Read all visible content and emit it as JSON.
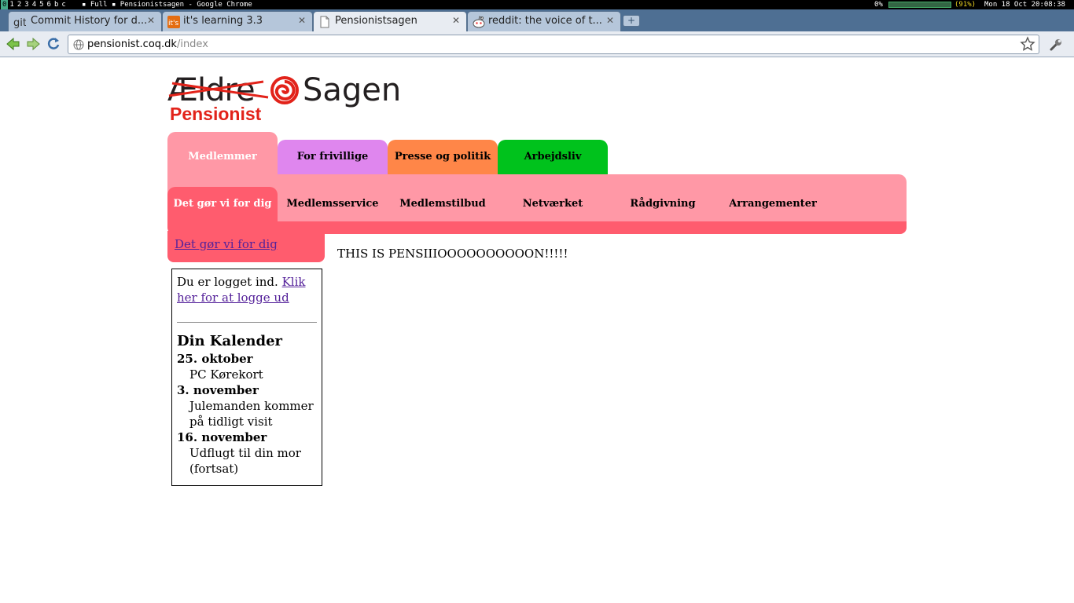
{
  "wm_bar": {
    "workspaces": [
      "0",
      "1",
      "2",
      "3",
      "4",
      "5",
      "6",
      "b",
      "c"
    ],
    "active_workspace": "0",
    "layout": "Full",
    "window_title": "Pensionistsagen - Google Chrome",
    "cpu": "0%",
    "battery": "(91%)",
    "clock": "Mon 18 Oct 20:08:38"
  },
  "browser": {
    "tabs": [
      {
        "label": "Commit History for d...",
        "favicon": "git-icon"
      },
      {
        "label": "it's learning 3.3",
        "favicon": "itslearning-icon"
      },
      {
        "label": "Pensionistsagen",
        "favicon": "page-icon"
      },
      {
        "label": "reddit: the voice of t...",
        "favicon": "reddit-icon"
      }
    ],
    "new_tab_label": "+",
    "close_glyph": "✕",
    "url_host": "pensionist.coq.dk",
    "url_path": "/index"
  },
  "logo": {
    "word1": "Ældre",
    "word2": "Sagen",
    "subtitle": "Pensionist"
  },
  "main_tabs": [
    {
      "label": "Medlemmer",
      "color": "#ff98a6"
    },
    {
      "label": "For frivillige",
      "color": "#df86ee"
    },
    {
      "label": "Presse og politik",
      "color": "#ff8648"
    },
    {
      "label": "Arbejdsliv",
      "color": "#00c21c"
    }
  ],
  "sub_nav": [
    "Det gør vi for dig",
    "Medlemsservice",
    "Medlemstilbud",
    "Netværket",
    "Rådgivning",
    "Arrangementer"
  ],
  "left_link": "Det gør vi for dig",
  "sidebox": {
    "login_text": "Du er logget ind.",
    "logout_link": "Klik her for at logge ud",
    "calendar_title": "Din Kalender",
    "events": [
      {
        "date": "25. oktober",
        "text": "PC Kørekort"
      },
      {
        "date": "3. november",
        "text": "Julemanden kommer på tidligt visit"
      },
      {
        "date": "16. november",
        "text": "Udflugt til din mor (fortsat)"
      }
    ]
  },
  "main_content": "THIS IS PENSIIIOOOOOOOOOON!!!!!",
  "colors": {
    "pink": "#ff98a6",
    "dark_pink": "#ff5c6e",
    "purple": "#df86ee",
    "orange": "#ff8648",
    "green": "#00c21c",
    "brand_red": "#e2231a"
  }
}
